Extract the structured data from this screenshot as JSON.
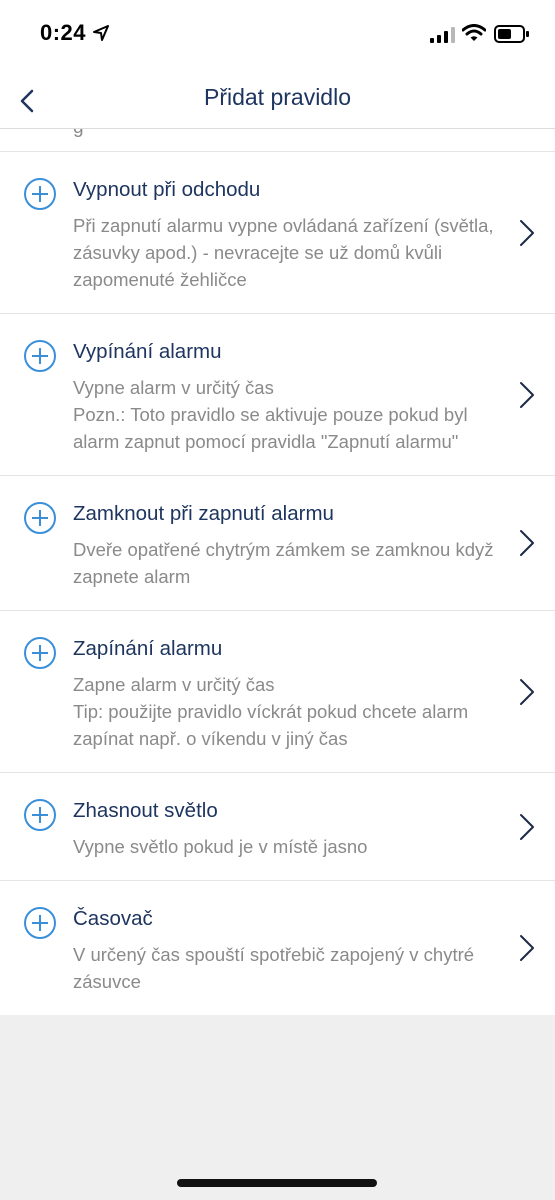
{
  "status_bar": {
    "time": "0:24"
  },
  "nav": {
    "title": "Přidat pravidlo"
  },
  "partial_row_text": "g",
  "rules": [
    {
      "title": "Vypnout při odchodu",
      "description": "Při zapnutí alarmu vypne ovládaná zařízení (světla, zásuvky apod.) - nevracejte se už domů kvůli zapomenuté žehličce"
    },
    {
      "title": "Vypínání alarmu",
      "description": "Vypne alarm v určitý čas\nPozn.: Toto pravidlo se aktivuje pouze pokud byl alarm zapnut pomocí pravidla \"Zapnutí alarmu\""
    },
    {
      "title": "Zamknout při zapnutí alarmu",
      "description": "Dveře opatřené chytrým zámkem se zamknou když zapnete alarm"
    },
    {
      "title": "Zapínání alarmu",
      "description": "Zapne alarm v určitý čas\nTip: použijte pravidlo víckrát pokud chcete alarm zapínat např. o víkendu v jiný čas"
    },
    {
      "title": "Zhasnout světlo",
      "description": "Vypne světlo pokud je v místě jasno"
    },
    {
      "title": "Časovač",
      "description": "V určený čas spouští spotřebič zapojený v chytré zásuvce"
    }
  ],
  "colors": {
    "accent": "#3a8fd9",
    "title_text": "#1e3560",
    "secondary_text": "#8a8a8a",
    "background": "#efefef"
  },
  "icons": {
    "back": "chevron-left-icon",
    "add": "plus-circle-icon",
    "disclosure": "chevron-right-icon",
    "location": "location-arrow-icon",
    "signal": "cellular-signal-icon",
    "wifi": "wifi-icon",
    "battery": "battery-icon"
  }
}
